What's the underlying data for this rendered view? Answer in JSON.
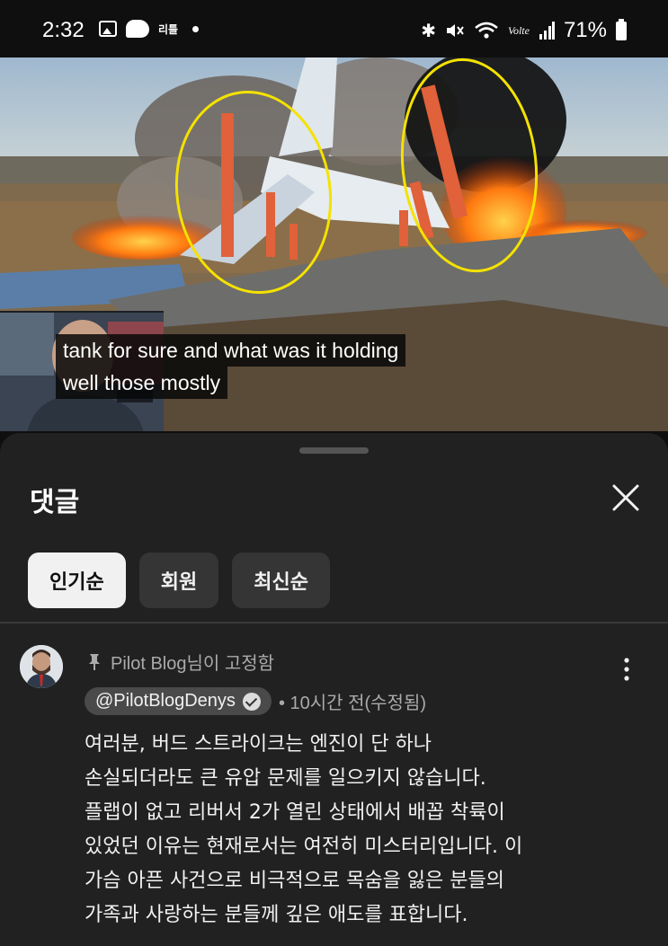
{
  "status_bar": {
    "time": "2:32",
    "notif_text": "리틀",
    "volte": "Volte",
    "battery": "71%",
    "icons": [
      "gallery-icon",
      "chat-bubble-icon",
      "bluetooth-icon",
      "mute-icon",
      "wifi-icon",
      "signal-icon",
      "battery-icon"
    ]
  },
  "video": {
    "caption_lines": [
      "tank for sure and what was it holding",
      "well those mostly"
    ]
  },
  "sheet": {
    "title": "댓글",
    "chips": [
      {
        "label": "인기순",
        "active": true
      },
      {
        "label": "회원",
        "active": false
      },
      {
        "label": "최신순",
        "active": false
      }
    ]
  },
  "comment": {
    "pinned_text": "Pilot Blog님이 고정함",
    "author": "@PilotBlogDenys",
    "meta": "• 10시간 전(수정됨)",
    "body_lines": [
      "여러분, 버드 스트라이크는 엔진이 단 하나",
      "손실되더라도 큰 유압 문제를 일으키지 않습니다.",
      "플랩이 없고 리버서 2가 열린 상태에서 배꼽 착륙이",
      "있었던 이유는 현재로서는 여전히 미스터리입니다. 이",
      "가슴 아픈 사건으로 비극적으로 목숨을 잃은 분들의",
      "가족과 사랑하는 분들께 깊은 애도를 표합니다."
    ]
  },
  "colors": {
    "background": "#0f0f0f",
    "sheet": "#212121",
    "chip": "#353535",
    "chip_active": "#f1f1f1",
    "annotation": "#f4e200"
  }
}
